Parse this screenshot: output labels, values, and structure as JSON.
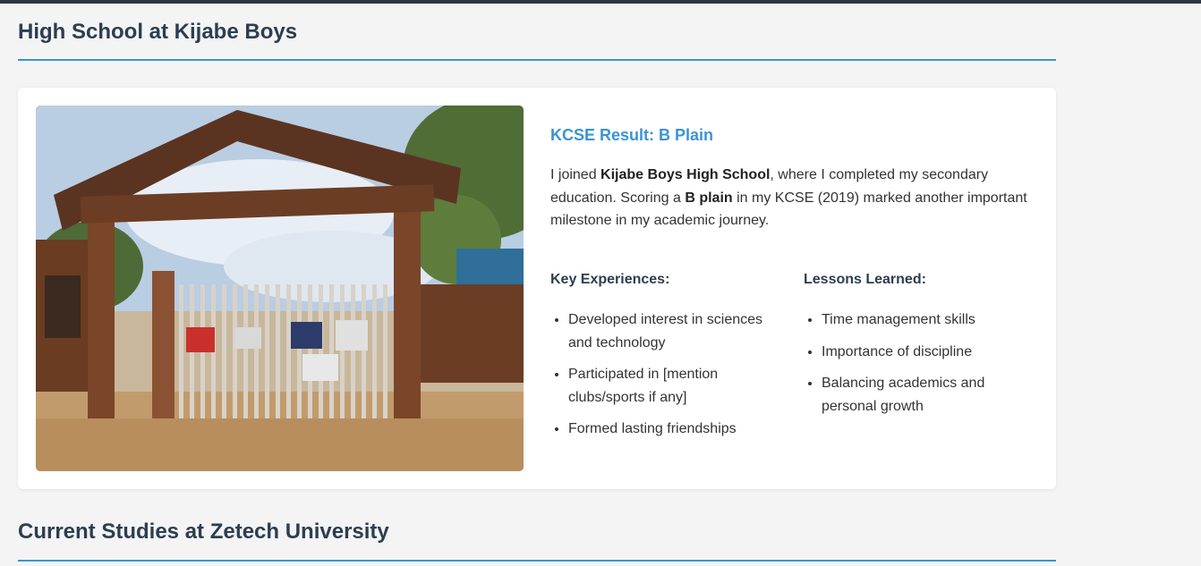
{
  "sections": {
    "high_school_title": "High School at Kijabe Boys",
    "next_title": "Current Studies at Zetech University"
  },
  "card": {
    "result": "KCSE Result: B Plain",
    "intro": {
      "p1": "I joined ",
      "school": "Kijabe Boys High School",
      "p2": ", where I completed my secondary education. Scoring a ",
      "grade": "B plain",
      "p3": " in my KCSE (2019) marked another important milestone in my academic journey."
    },
    "key_experiences": {
      "heading": "Key Experiences:",
      "items": [
        "Developed interest in sciences and technology",
        "Participated in [mention clubs/sports if any]",
        "Formed lasting friendships"
      ]
    },
    "lessons": {
      "heading": "Lessons Learned:",
      "items": [
        "Time management skills",
        "Importance of discipline",
        "Balancing academics and personal growth"
      ]
    }
  },
  "colors": {
    "accent": "#3a94d4",
    "heading": "#2c3e50",
    "background": "#f4f4f4"
  }
}
